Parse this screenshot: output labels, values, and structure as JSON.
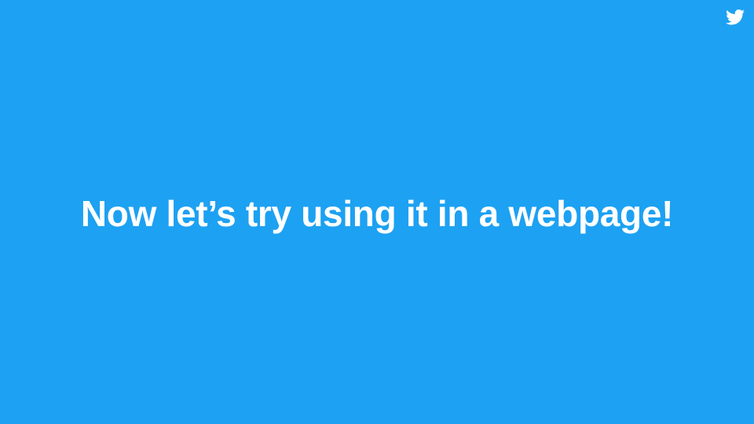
{
  "slide": {
    "headline": "Now let’s try using it in a webpage!"
  },
  "logo": {
    "icon": "twitter-bird-icon"
  },
  "colors": {
    "background": "#1DA1F2",
    "text": "#FFFFFF",
    "logo": "#FFFFFF"
  }
}
